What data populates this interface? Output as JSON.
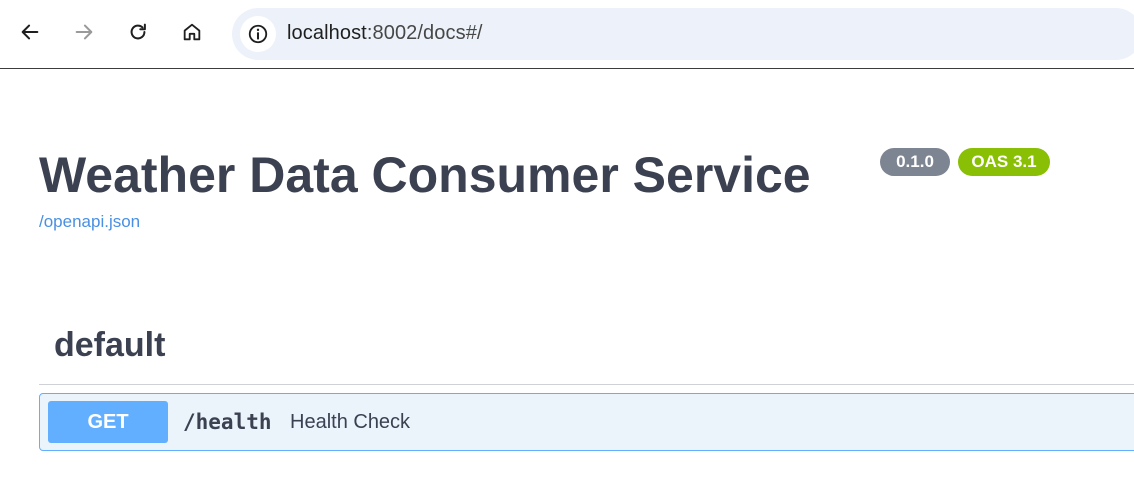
{
  "browser": {
    "url_host": "localhost",
    "url_rest": ":8002/docs#/",
    "icons": [
      "back-arrow-icon",
      "forward-arrow-icon",
      "reload-icon",
      "home-icon",
      "info-icon"
    ]
  },
  "info": {
    "title": "Weather Data Consumer Service",
    "version": "0.1.0",
    "oas_version": "OAS 3.1",
    "spec_link": "/openapi.json"
  },
  "tags": [
    {
      "name": "default",
      "operations": [
        {
          "method": "GET",
          "path": "/health",
          "summary": "Health Check"
        }
      ]
    }
  ],
  "colors": {
    "get_method": "#61affe",
    "get_background": "#ebf3fb",
    "version_badge": "#7d8492",
    "oas_badge": "#89bf04",
    "link": "#4990e2",
    "text": "#3b4151"
  }
}
